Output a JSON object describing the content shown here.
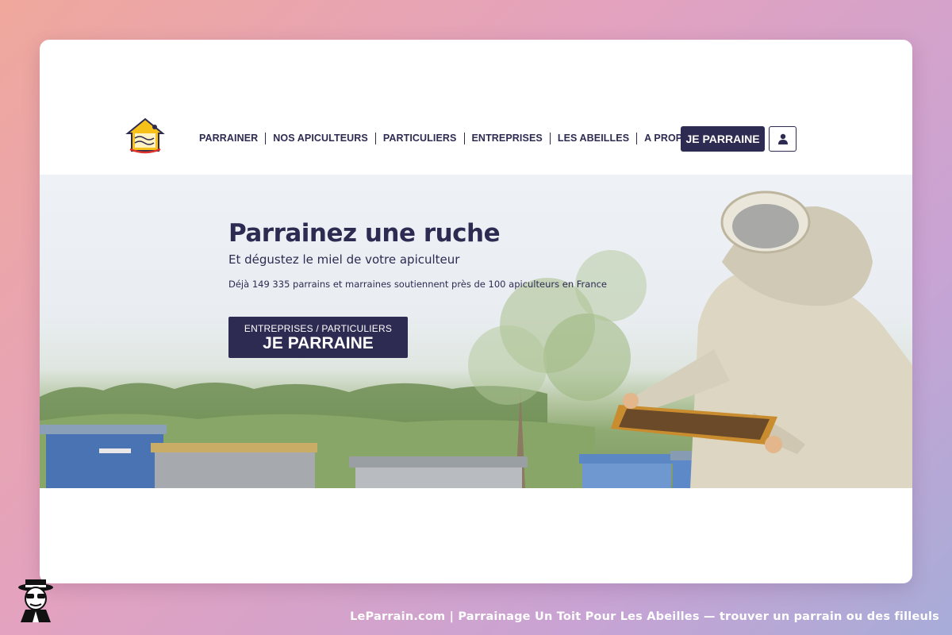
{
  "colors": {
    "brand_navy": "#2e2b52",
    "background_gradient": [
      "#f0a89c",
      "#e3a2bf",
      "#c9a3d3",
      "#a7acd8"
    ],
    "card": "#ffffff"
  },
  "header": {
    "logo_icon": "un-toit-pour-les-abeilles-logo",
    "nav": [
      {
        "label": "PARRAINER"
      },
      {
        "label": "NOS APICULTEURS"
      },
      {
        "label": "PARTICULIERS"
      },
      {
        "label": "ENTREPRISES"
      },
      {
        "label": "LES ABEILLES"
      },
      {
        "label": "A PROPOS"
      }
    ],
    "cta_label": "JE PARRAINE",
    "account_icon": "user-icon"
  },
  "hero": {
    "title": "Parrainez une ruche",
    "subtitle": "Et dégustez le miel de votre apiculteur",
    "stats": "Déjà 149 335 parrains et marraines soutiennent près de 100 apiculteurs en France",
    "cta_small": "ENTREPRISES / PARTICULIERS",
    "cta_big": "JE PARRAINE",
    "image_icon": "beekeeper-hives-photo"
  },
  "footer": {
    "caption": "LeParrain.com | Parrainage Un Toit Pour Les Abeilles — trouver un parrain ou des filleuls",
    "mascot_icon": "leparrain-mascot-icon"
  }
}
